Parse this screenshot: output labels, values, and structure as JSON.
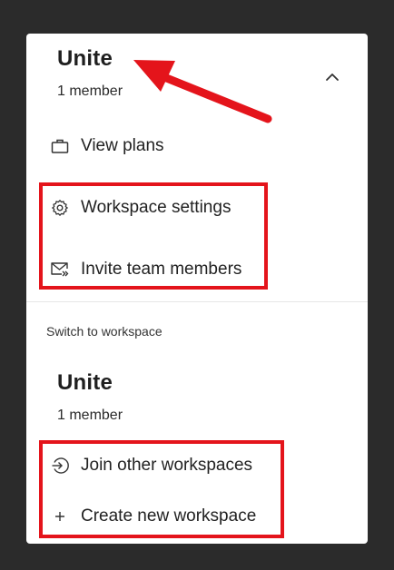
{
  "workspace": {
    "name": "Unite",
    "member_count": "1 member"
  },
  "menu": {
    "view_plans": "View plans",
    "workspace_settings": "Workspace settings",
    "invite_team_members": "Invite team members"
  },
  "switcher": {
    "section_label": "Switch to workspace",
    "workspace_name": "Unite",
    "workspace_member_count": "1 member",
    "join_other": "Join other workspaces",
    "create_new": "Create new workspace"
  },
  "icons": {
    "chevron": "chevron-up-icon",
    "view_plans": "briefcase-icon",
    "workspace_settings": "gear-icon",
    "invite_team_members": "mail-invite-icon",
    "join_other": "sign-in-icon",
    "create_new": "plus-icon"
  },
  "annotation_color": "#e4141b"
}
